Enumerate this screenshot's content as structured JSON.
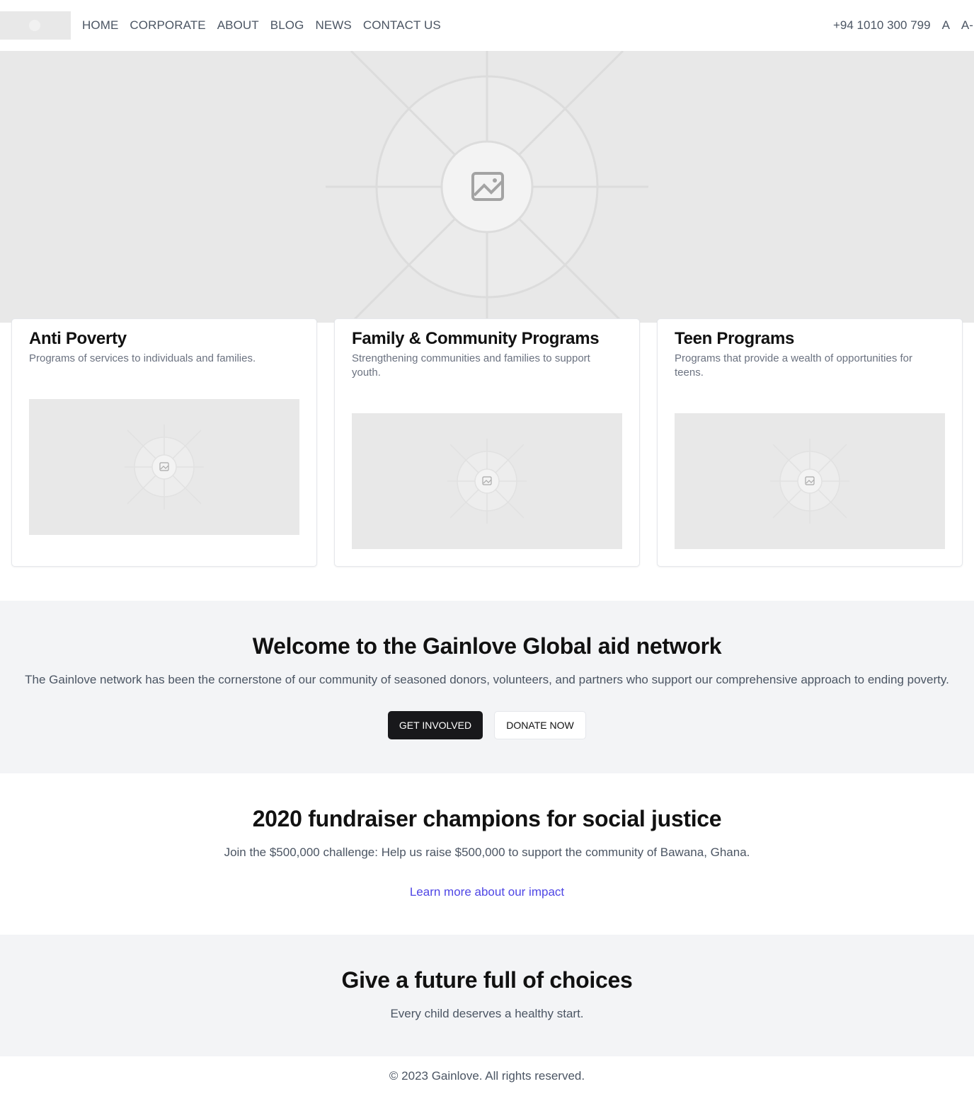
{
  "header": {
    "nav": [
      "HOME",
      "CORPORATE",
      "ABOUT",
      "BLOG",
      "NEWS",
      "CONTACT US"
    ],
    "phone": "+94 1010 300 799",
    "font_increase": "A",
    "font_decrease": "A-"
  },
  "hero": {
    "icon": "image-placeholder-icon"
  },
  "cards": [
    {
      "title": "Anti Poverty",
      "description": "Programs of services to individuals and families.",
      "icon": "image-placeholder-icon"
    },
    {
      "title": "Family & Community Programs",
      "description": "Strengthening communities and families to support youth.",
      "icon": "image-placeholder-icon"
    },
    {
      "title": "Teen Programs",
      "description": "Programs that provide a wealth of opportunities for teens.",
      "icon": "image-placeholder-icon"
    }
  ],
  "welcome": {
    "heading": "Welcome to the Gainlove Global aid network",
    "text": "The Gainlove network has been the cornerstone of our community of seasoned donors, volunteers, and partners who support our comprehensive approach to ending poverty.",
    "primary_button": "GET INVOLVED",
    "secondary_button": "DONATE NOW"
  },
  "fundraiser": {
    "heading": "2020 fundraiser champions for social justice",
    "text": "Join the $500,000 challenge: Help us raise $500,000 to support the community of Bawana, Ghana.",
    "link": "Learn more about our impact"
  },
  "future": {
    "heading": "Give a future full of choices",
    "text": "Every child deserves a healthy start."
  },
  "footer": {
    "copyright": "© 2023 Gainlove. All rights reserved."
  },
  "colors": {
    "placeholder_bg": "#e8e8e8",
    "section_bg": "#f3f4f6",
    "primary_button": "#18181b",
    "link": "#4f46e5",
    "muted_text": "#4b5563"
  }
}
